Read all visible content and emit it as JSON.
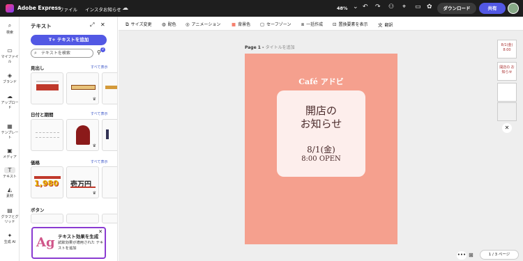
{
  "topbar": {
    "app_name": "Adobe Express",
    "menu_file": "ファイル",
    "menu_doc": "インスタお知らせ",
    "zoom": "48%",
    "download": "ダウンロード",
    "share": "共有",
    "icons": [
      "cloud-icon",
      "undo-icon",
      "redo-icon",
      "user-add-icon",
      "location-icon",
      "comment-icon",
      "gift-icon",
      "settings-icon"
    ]
  },
  "rail": {
    "items": [
      {
        "label": "検索",
        "icon": "⌕"
      },
      {
        "label": "マイファイル",
        "icon": "▭"
      },
      {
        "label": "ブランド",
        "icon": "◈"
      },
      {
        "label": "アップロード",
        "icon": "☁"
      },
      {
        "label": "テンプレート",
        "icon": "▦"
      },
      {
        "label": "メディア",
        "icon": "▣"
      },
      {
        "label": "テキスト",
        "icon": "T"
      },
      {
        "label": "素材",
        "icon": "◭"
      },
      {
        "label": "グラフとグリッド",
        "icon": "▤"
      },
      {
        "label": "生成 AI",
        "icon": "✦"
      }
    ]
  },
  "panel": {
    "title": "テキスト",
    "add_text": "テキストを追加",
    "search_placeholder": "テキストを検索",
    "filter_badge": "2",
    "see_all": "すべて表示",
    "sections": [
      {
        "title": "見出し"
      },
      {
        "title": "日付と期間"
      },
      {
        "title": "価格"
      },
      {
        "title": "ボタン"
      }
    ],
    "thumb_texts": {
      "price1": "1,980",
      "price2": "壱万円"
    },
    "promo": {
      "title": "テキスト効果を生成",
      "desc": "試飲効果が適用された テキストを追加",
      "ag": "Ag"
    }
  },
  "toolbar": {
    "items": [
      "サイズ変更",
      "配色",
      "アニメーション",
      "背景色",
      "セーフゾーン",
      "一括作成",
      "置換要素を表示",
      "翻訳"
    ]
  },
  "canvas": {
    "page_label": "Page 1 -",
    "page_title_placeholder": "タイトルを追加",
    "cafe": "Café アドビ",
    "heading_line1": "開店の",
    "heading_line2": "お知らせ",
    "date": "8/1(金)",
    "time": "8:00 OPEN",
    "bg_color": "#f5a08e",
    "card_color": "#fdeeec"
  },
  "pages": {
    "thumb1": "8/1(金) 8:00",
    "thumb2": "開店の お知らせ",
    "page_counter": "1 / 3 ページ"
  }
}
